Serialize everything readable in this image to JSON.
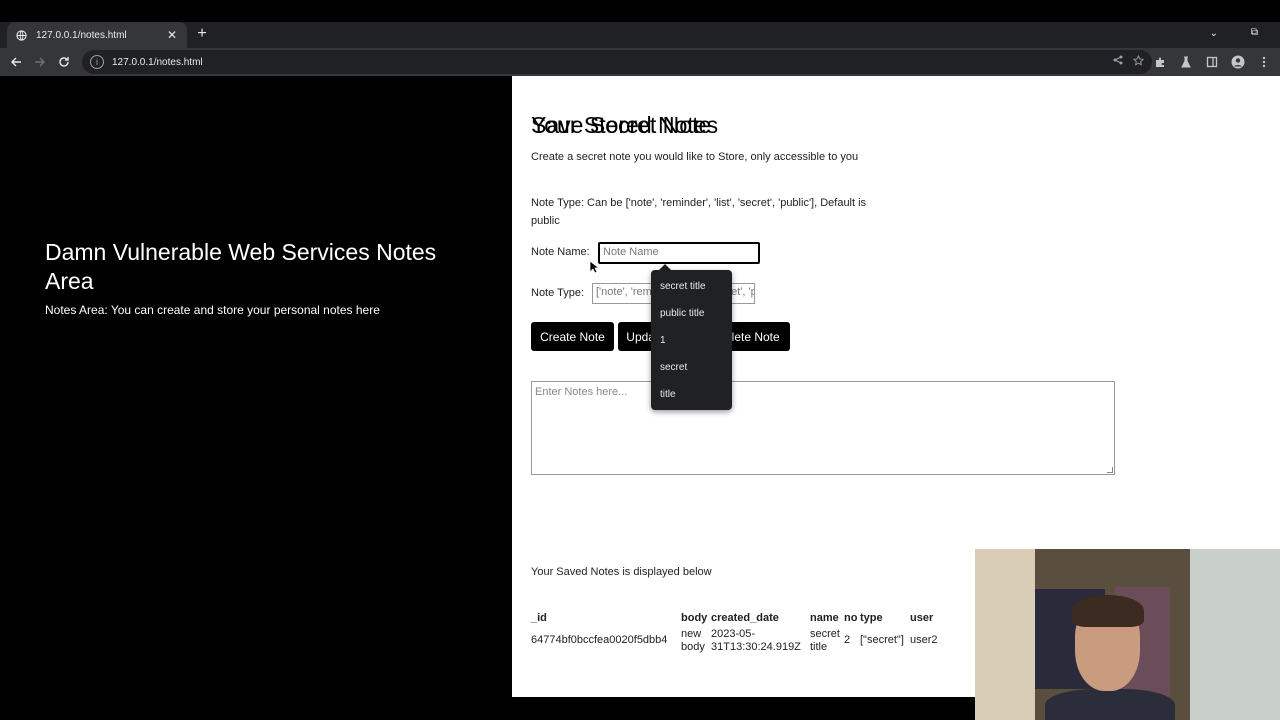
{
  "browser": {
    "tab_title": "127.0.0.1/notes.html",
    "tab_close": "✕",
    "new_tab": "+",
    "url": "127.0.0.1/notes.html",
    "tab_menu": "⌄",
    "restore": "⧉"
  },
  "sidebar": {
    "title": "Damn Vulnerable Web Services Notes Area",
    "subtitle": "Notes Area: You can create and store your personal notes here"
  },
  "form": {
    "heading": "Save Secret Note",
    "description": "Create a secret note you would like to Store, only accessible to you",
    "note_type_desc": "Note Type: Can be ['note', 'reminder', 'list', 'secret', 'public'], Default is public",
    "note_name_label": "Note Name:",
    "note_name_placeholder": "Note Name",
    "note_type_label": "Note Type:",
    "note_type_placeholder": "['note', 'reminder', 'list', 'secret', 'public']",
    "buttons": {
      "create": "Create Note",
      "update": "Update Note",
      "delete": "Delete Note"
    },
    "notes_placeholder": "Enter Notes here..."
  },
  "autocomplete": {
    "items": [
      "secret title",
      "public title",
      "1",
      "secret",
      "title"
    ]
  },
  "stored": {
    "heading": "Your Stored Notes",
    "description": "Your Saved Notes is displayed below",
    "columns": [
      "_id",
      "body",
      "created_date",
      "name",
      "no",
      "type",
      "user"
    ],
    "rows": [
      {
        "_id": "64774bf0bccfea0020f5dbb4",
        "body": "new body",
        "created_date": "2023-05-31T13:30:24.919Z",
        "name": "secret title",
        "no": "2",
        "type": "[\"secret\"]",
        "user": "user2"
      }
    ]
  },
  "icons": [
    "globe-icon",
    "back-icon",
    "forward-icon",
    "reload-icon",
    "info-icon",
    "share-icon",
    "star-icon",
    "extensions-icon",
    "flask-icon",
    "sidepanel-icon",
    "profile-icon",
    "menu-icon"
  ]
}
